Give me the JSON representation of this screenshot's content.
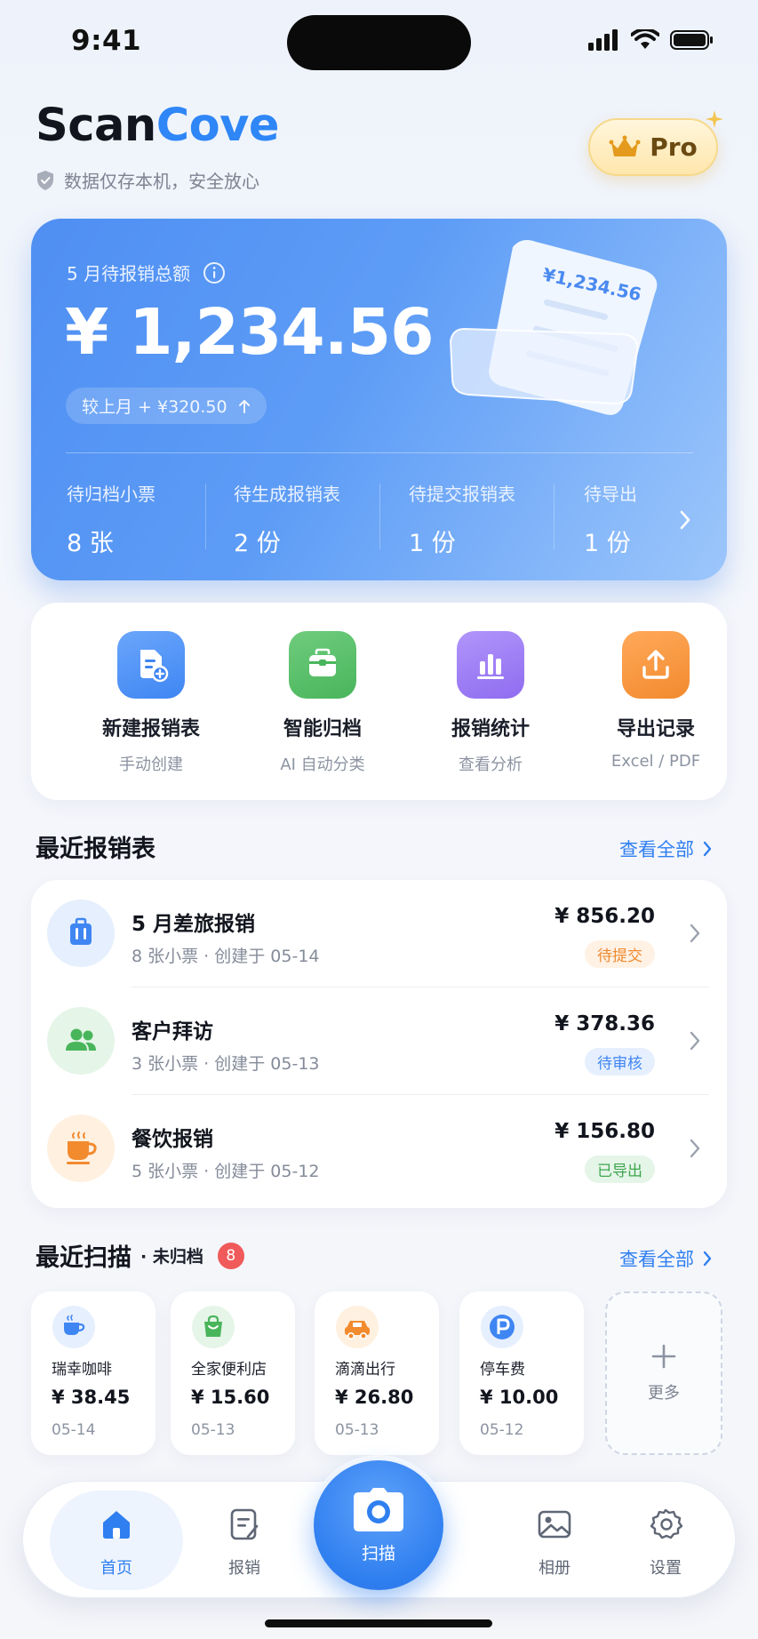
{
  "status": {
    "time": "9:41"
  },
  "header": {
    "brand_part1": "Scan",
    "brand_part2": "Cove",
    "tagline": "数据仅存本机，安全放心",
    "pro_label": "Pro"
  },
  "summary": {
    "label": "5 月待报销总额",
    "amount": "¥ 1,234.56",
    "change": "较上月 + ¥320.50",
    "receipt_text": "¥1,234.56",
    "stats": [
      {
        "label": "待归档小票",
        "value": "8 张"
      },
      {
        "label": "待生成报销表",
        "value": "2 份"
      },
      {
        "label": "待提交报销表",
        "value": "1 份"
      },
      {
        "label": "待导出",
        "value": "1 份"
      }
    ]
  },
  "actions": [
    {
      "title": "新建报销表",
      "subtitle": "手动创建",
      "icon": "new-document-icon",
      "color": "#3f86f3"
    },
    {
      "title": "智能归档",
      "subtitle": "AI 自动分类",
      "icon": "archive-box-icon",
      "color": "#49b55b"
    },
    {
      "title": "报销统计",
      "subtitle": "查看分析",
      "icon": "bar-chart-icon",
      "color": "#8f6cf0"
    },
    {
      "title": "导出记录",
      "subtitle": "Excel / PDF",
      "icon": "export-icon",
      "color": "#f28a2e"
    }
  ],
  "recent_reports": {
    "title": "最近报销表",
    "view_all": "查看全部",
    "items": [
      {
        "title": "5 月差旅报销",
        "meta": "8 张小票 · 创建于 05-14",
        "amount": "¥ 856.20",
        "status": "待提交",
        "icon": "luggage-icon"
      },
      {
        "title": "客户拜访",
        "meta": "3 张小票 · 创建于 05-13",
        "amount": "¥ 378.36",
        "status": "待审核",
        "icon": "people-icon"
      },
      {
        "title": "餐饮报销",
        "meta": "5 张小票 · 创建于 05-12",
        "amount": "¥ 156.80",
        "status": "已导出",
        "icon": "coffee-cup-icon"
      }
    ]
  },
  "recent_scans": {
    "title": "最近扫描",
    "subtitle": "· 未归档",
    "count": "8",
    "view_all": "查看全部",
    "items": [
      {
        "name": "瑞幸咖啡",
        "amount": "¥ 38.45",
        "date": "05-14",
        "icon": "coffee-icon"
      },
      {
        "name": "全家便利店",
        "amount": "¥ 15.60",
        "date": "05-13",
        "icon": "shopping-bag-icon"
      },
      {
        "name": "滴滴出行",
        "amount": "¥ 26.80",
        "date": "05-13",
        "icon": "car-icon"
      },
      {
        "name": "停车费",
        "amount": "¥ 10.00",
        "date": "05-12",
        "icon": "parking-icon"
      }
    ],
    "more_label": "更多"
  },
  "tabbar": {
    "home": "首页",
    "reports": "报销",
    "scan": "扫描",
    "album": "相册",
    "settings": "设置"
  },
  "colors": {
    "accent": "#2f7ff0",
    "pending_submit": "#f28a2e",
    "pending_review": "#3f86f3",
    "exported": "#49b55b",
    "badge": "#f05a5a"
  }
}
